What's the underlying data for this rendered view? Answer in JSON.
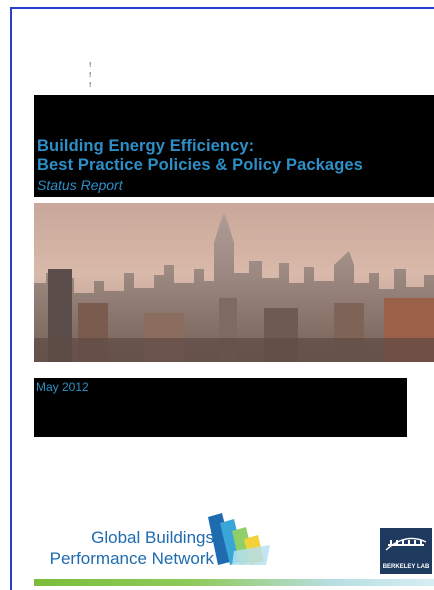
{
  "cover": {
    "marks": [
      "!",
      "!",
      "!"
    ],
    "title_line1": "Building Energy Efficiency:",
    "title_line2": "Best Practice Policies & Policy Packages",
    "subtitle": "Status Report",
    "date": "May 2012",
    "photo_icon": "city-skyline-photo",
    "colors": {
      "title": "#2d8fc7",
      "band": "#000000",
      "frame": "#2a3fd0"
    }
  },
  "logos": {
    "gbpn_line1": "Global Buildings",
    "gbpn_line2": "Performance Network",
    "gbpn_icon": "gbpn-logo-icon",
    "berkeley_label": "BERKELEY LAB",
    "berkeley_icon": "berkeley-lab-logo-icon"
  }
}
